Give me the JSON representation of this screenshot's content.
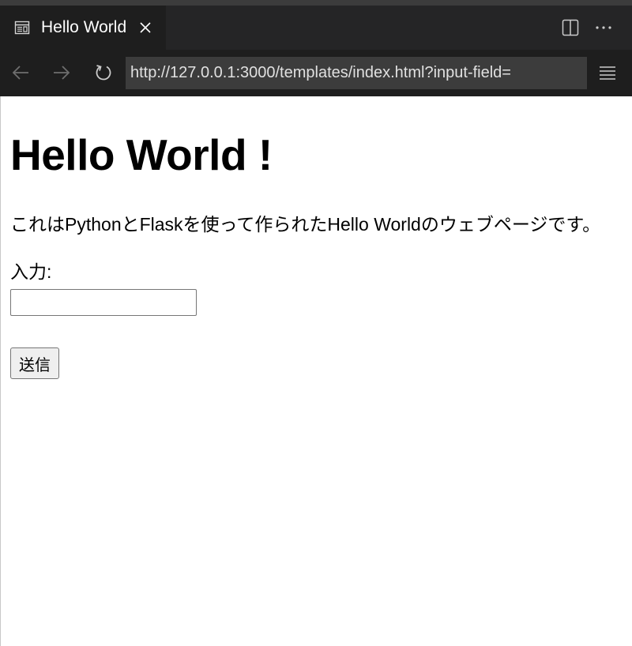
{
  "tab": {
    "title": "Hello World"
  },
  "navbar": {
    "url": "http://127.0.0.1:3000/templates/index.html?input-field="
  },
  "page": {
    "heading": "Hello World !",
    "description": "これはPythonとFlaskを使って作られたHello Worldのウェブページです。",
    "form": {
      "label": "入力:",
      "input_value": "",
      "submit_label": "送信"
    }
  },
  "icons": {
    "tab": "preview-icon",
    "close": "close-icon",
    "split": "split-editor-icon",
    "more": "more-actions-icon",
    "back": "arrow-left-icon",
    "forward": "arrow-right-icon",
    "reload": "reload-icon",
    "menu": "menu-icon"
  },
  "colors": {
    "chrome_bg": "#1e1e1e",
    "tabbar_bg": "#252526",
    "url_bg": "#3c3c3c",
    "page_bg": "#ffffff"
  }
}
